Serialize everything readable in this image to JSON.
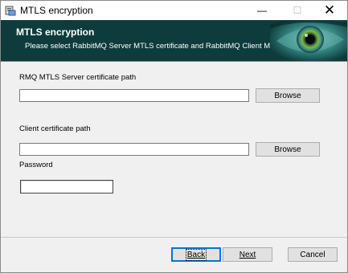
{
  "window": {
    "title": "MTLS encryption",
    "minimize_glyph": "—",
    "maximize_glyph": "☐",
    "close_glyph": "✕"
  },
  "banner": {
    "title": "MTLS encryption",
    "subtitle": "Please select RabbitMQ Server MTLS certificate and  RabbitMQ Client MTLS ...",
    "image_icon": "eye-icon"
  },
  "form": {
    "server_cert_label": "RMQ MTLS Server certificate path",
    "server_cert_value": "",
    "client_cert_label": "Client certificate path",
    "client_cert_value": "",
    "password_label": "Password",
    "password_value": "",
    "browse_label": "Browse"
  },
  "footer": {
    "back_label": "Back",
    "next_label": "Next",
    "cancel_label": "Cancel"
  },
  "colors": {
    "banner_background": "#0e3b3b",
    "focus_border": "#0078d7"
  }
}
